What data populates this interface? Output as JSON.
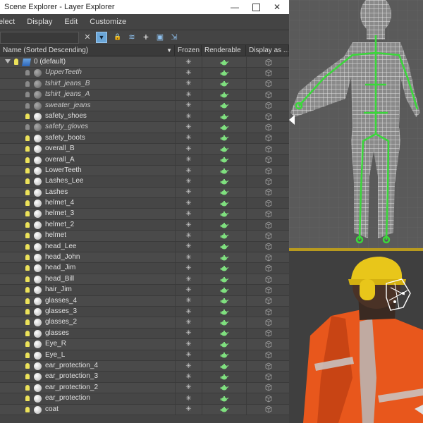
{
  "window": {
    "title": "Scene Explorer - Layer Explorer",
    "min_glyph": "—",
    "close_glyph": "✕"
  },
  "menu": [
    "elect",
    "Display",
    "Edit",
    "Customize"
  ],
  "toolbar": {
    "icons": [
      "close-icon",
      "filter-icon",
      "lock-icon",
      "layers-icon",
      "add-icon",
      "select-icon",
      "move-icon"
    ],
    "glyphs": {
      "close": "✕",
      "filter": "▼",
      "lock": "🔒",
      "layers": "≋",
      "add": "+",
      "select": "▣",
      "move": "⇲"
    }
  },
  "columns": {
    "name": "Name (Sorted Descending)",
    "frozen": "Frozen",
    "renderable": "Renderable",
    "display": "Display as ..."
  },
  "root_layer": "0 (default)",
  "items": [
    {
      "name": "UpperTeeth",
      "hidden": true
    },
    {
      "name": "tshirt_jeans_B",
      "hidden": true
    },
    {
      "name": "tshirt_jeans_A",
      "hidden": true
    },
    {
      "name": "sweater_jeans",
      "hidden": true
    },
    {
      "name": "safety_shoes",
      "hidden": false
    },
    {
      "name": "safety_gloves",
      "hidden": true
    },
    {
      "name": "safety_boots",
      "hidden": false
    },
    {
      "name": "overall_B",
      "hidden": false
    },
    {
      "name": "overall_A",
      "hidden": false
    },
    {
      "name": "LowerTeeth",
      "hidden": false
    },
    {
      "name": "Lashes_Lee",
      "hidden": false
    },
    {
      "name": "Lashes",
      "hidden": false
    },
    {
      "name": "helmet_4",
      "hidden": false
    },
    {
      "name": "helmet_3",
      "hidden": false
    },
    {
      "name": "helmet_2",
      "hidden": false
    },
    {
      "name": "helmet",
      "hidden": false
    },
    {
      "name": "head_Lee",
      "hidden": false
    },
    {
      "name": "head_John",
      "hidden": false
    },
    {
      "name": "head_Jim",
      "hidden": false
    },
    {
      "name": "head_Bill",
      "hidden": false
    },
    {
      "name": "hair_Jim",
      "hidden": false
    },
    {
      "name": "glasses_4",
      "hidden": false
    },
    {
      "name": "glasses_3",
      "hidden": false
    },
    {
      "name": "glasses_2",
      "hidden": false
    },
    {
      "name": "glasses",
      "hidden": false
    },
    {
      "name": "Eye_R",
      "hidden": false
    },
    {
      "name": "Eye_L",
      "hidden": false
    },
    {
      "name": "ear_protection_4",
      "hidden": false
    },
    {
      "name": "ear_protection_3",
      "hidden": false
    },
    {
      "name": "ear_protection_2",
      "hidden": false
    },
    {
      "name": "ear_protection",
      "hidden": false
    },
    {
      "name": "coat",
      "hidden": false
    }
  ],
  "colors": {
    "bg": "#444444",
    "accent": "#6aa6d8",
    "bulb_on": "#ece25a",
    "teapot": "#7fe07f",
    "wire": "#dcdcdc",
    "bone": "#3ad83a",
    "vest": "#e8571c",
    "helmet": "#e8c61a"
  }
}
